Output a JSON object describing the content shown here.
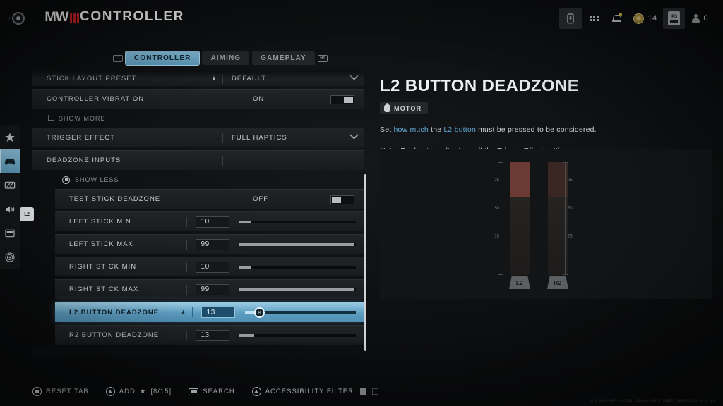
{
  "header": {
    "back_chevron": "‹",
    "logo_word": "MW",
    "title": "CONTROLLER",
    "hud": {
      "battery_icon": "battery-icon",
      "apps_icon": "apps-grid-icon",
      "notifications_icon": "bell-icon",
      "currency_icon": "coin-icon",
      "currency_value": "14",
      "platform_card_label": "PS",
      "party_icon": "party-icon",
      "party_value": "0"
    }
  },
  "rail": {
    "items": [
      {
        "name": "favorites",
        "icon": "star-icon",
        "active": false
      },
      {
        "name": "controller",
        "icon": "gamepad-icon",
        "active": true
      },
      {
        "name": "graphics",
        "icon": "monitor-icon",
        "active": false
      },
      {
        "name": "audio",
        "icon": "speaker-icon",
        "active": false
      },
      {
        "name": "interface",
        "icon": "interface-icon",
        "active": false
      },
      {
        "name": "accessibility",
        "icon": "accessibility-icon",
        "active": false
      }
    ],
    "badge_label": "L2"
  },
  "tabs": {
    "left_bumper": "L1",
    "right_bumper": "R1",
    "items": [
      {
        "label": "CONTROLLER",
        "active": true
      },
      {
        "label": "AIMING",
        "active": false
      },
      {
        "label": "GAMEPLAY",
        "active": false
      }
    ]
  },
  "settings": {
    "stick_layout_preset": {
      "label": "STICK LAYOUT PRESET",
      "value": "DEFAULT",
      "star": "★",
      "control": "dropdown"
    },
    "controller_vibration": {
      "label": "CONTROLLER VIBRATION",
      "value": "ON",
      "control": "toggle",
      "toggle_state": "on"
    },
    "show_more": {
      "label": "SHOW MORE"
    },
    "trigger_effect": {
      "label": "TRIGGER EFFECT",
      "value": "FULL HAPTICS",
      "control": "dropdown"
    },
    "deadzone_inputs": {
      "label": "DEADZONE INPUTS",
      "value": "",
      "control": "collapse",
      "collapse_glyph": "—"
    },
    "show_less": {
      "label": "SHOW LESS"
    },
    "sub_rows": [
      {
        "label": "TEST STICK DEADZONE",
        "value": "OFF",
        "control": "toggle",
        "toggle_state": "off",
        "star": false,
        "selected": false
      },
      {
        "label": "LEFT STICK MIN",
        "value": "10",
        "control": "slider",
        "percent": 10,
        "star": false,
        "selected": false
      },
      {
        "label": "LEFT STICK MAX",
        "value": "99",
        "control": "slider",
        "percent": 99,
        "star": false,
        "selected": false
      },
      {
        "label": "RIGHT STICK MIN",
        "value": "10",
        "control": "slider",
        "percent": 10,
        "star": false,
        "selected": false
      },
      {
        "label": "RIGHT STICK MAX",
        "value": "99",
        "control": "slider",
        "percent": 99,
        "star": false,
        "selected": false
      },
      {
        "label": "L2 BUTTON DEADZONE",
        "value": "13",
        "control": "slider",
        "percent": 13,
        "star": true,
        "star_glyph": "★",
        "selected": true
      },
      {
        "label": "R2 BUTTON DEADZONE",
        "value": "13",
        "control": "slider",
        "percent": 13,
        "star": false,
        "selected": false
      }
    ]
  },
  "panel": {
    "title": "L2 BUTTON DEADZONE",
    "badge": {
      "icon": "motor-icon",
      "label": "MOTOR"
    },
    "description": {
      "part1": "Set ",
      "hl1": "how much",
      "part2": " the ",
      "hl2": "L2 button",
      "part3": " must be pressed to be considered."
    },
    "note": "Note: For best results, turn off the Trigger Effect setting.",
    "preview": {
      "meters": [
        {
          "label": "L2",
          "deadzone_percent": 13,
          "active": true
        },
        {
          "label": "R2",
          "deadzone_percent": 13,
          "active": false
        }
      ],
      "ticks": [
        "25",
        "50",
        "75"
      ]
    }
  },
  "bottom_bar": {
    "reset_tab": {
      "label": "RESET TAB",
      "button": "circle-button-icon"
    },
    "add_favorite": {
      "label_pre": "ADD",
      "star": "★",
      "count": "[8/15]",
      "button": "triangle-button-icon"
    },
    "search": {
      "label": "SEARCH",
      "button": "touchpad-icon"
    },
    "accessibility_filter": {
      "label": "ACCESSIBILITY FILTER",
      "button": "triangle-button-icon"
    }
  },
  "build_string": "18.0.10144407 (42:255:11014+11:A) T [605] T1696691502 p4.C un5"
}
